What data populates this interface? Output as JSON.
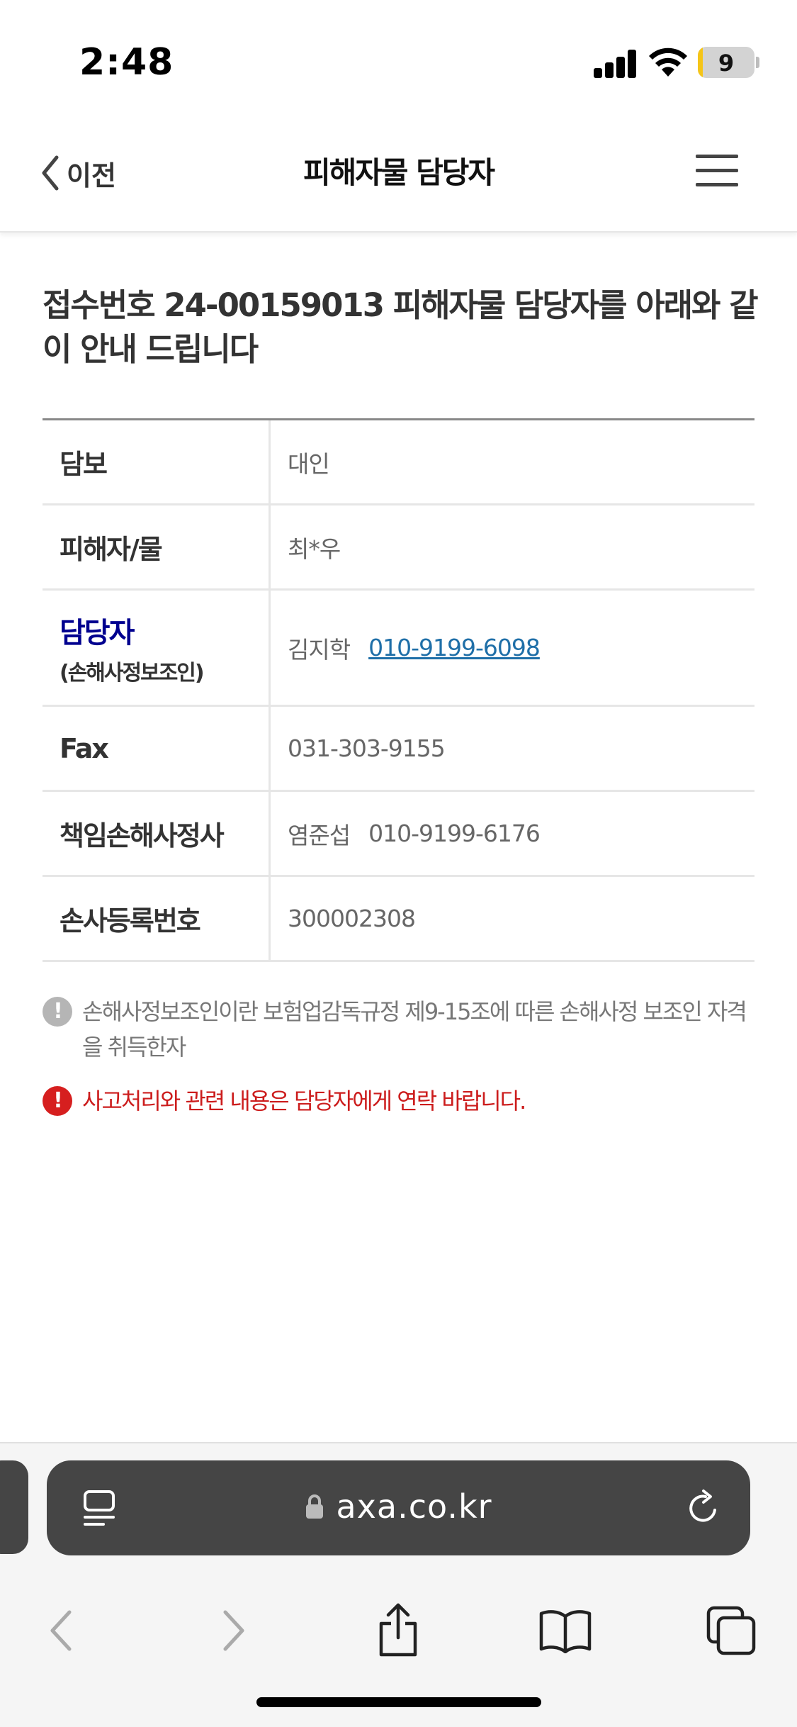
{
  "status": {
    "time": "2:48",
    "battery": "9"
  },
  "header": {
    "back_label": "이전",
    "title": "피해자물 담당자"
  },
  "heading": "접수번호 24-00159013 피해자물 담당자를 아래와 같이 안내 드립니다",
  "table": {
    "rows": [
      {
        "label": "담보",
        "value": "대인"
      },
      {
        "label": "피해자/물",
        "value": "최*우"
      },
      {
        "label": "담당자",
        "sublabel": "(손해사정보조인)",
        "name": "김지학",
        "phone": "010-9199-6098"
      },
      {
        "label": "Fax",
        "value": "031-303-9155"
      },
      {
        "label": "책임손해사정사",
        "name": "염준섭",
        "phone": "010-9199-6176"
      },
      {
        "label": "손사등록번호",
        "value": "300002308"
      }
    ]
  },
  "notes": {
    "info": "손해사정보조인이란 보험업감독규정 제9-15조에 따른 손해사정 보조인 자격을 취득한자",
    "warning": "사고처리와 관련 내용은 담당자에게 연락 바랍니다."
  },
  "browser": {
    "url": "axa.co.kr"
  },
  "colors": {
    "accent_blue": "#00008f",
    "link": "#1f6fa8",
    "warning_red": "#cc1d1d"
  }
}
